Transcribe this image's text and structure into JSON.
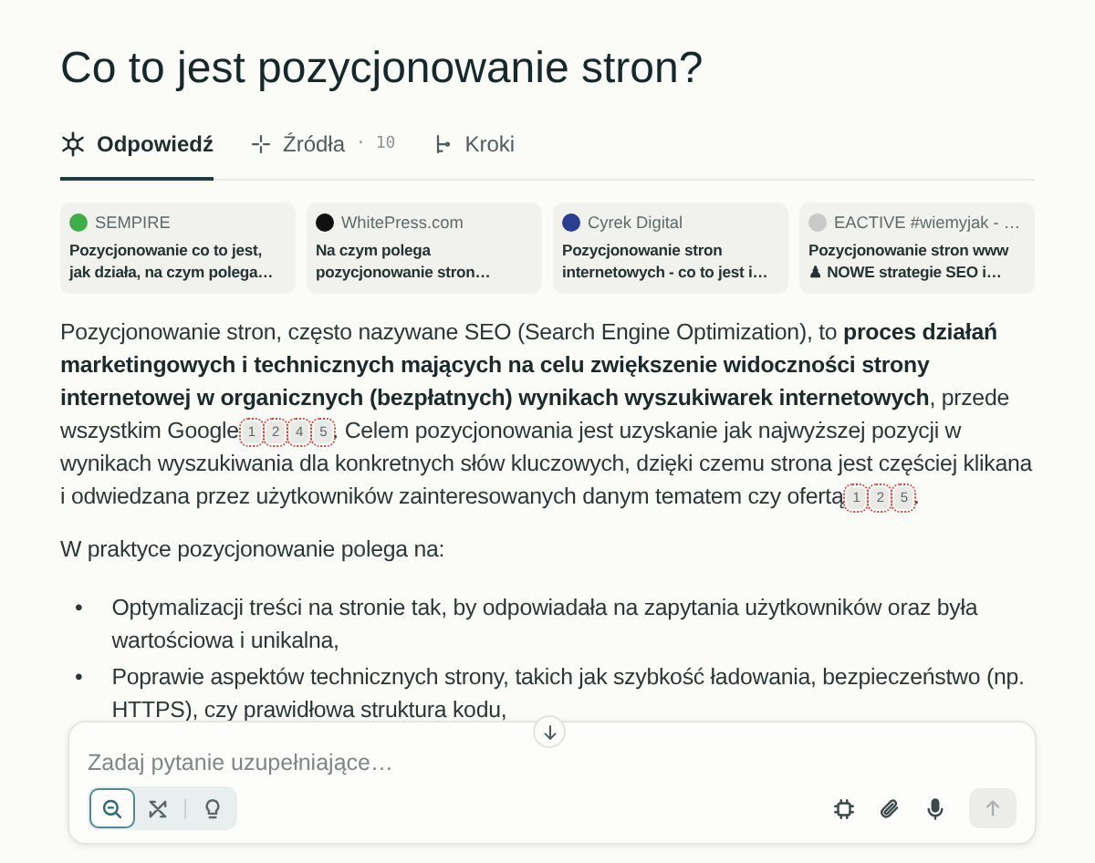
{
  "title": "Co to jest pozycjonowanie stron?",
  "tabs": [
    {
      "label": "Odpowiedź",
      "kind": "answer",
      "selected": true
    },
    {
      "label": "Źródła",
      "kind": "sources",
      "count": "· 10",
      "selected": false
    },
    {
      "label": "Kroki",
      "kind": "steps",
      "selected": false
    }
  ],
  "sources": [
    {
      "site": "SEMPIRE",
      "title": "Pozycjonowanie co to jest, jak działa, na czym polega…",
      "color": "#3fae49"
    },
    {
      "site": "WhitePress.com",
      "title": "Na czym polega pozycjonowanie stron…",
      "color": "#111111"
    },
    {
      "site": "Cyrek Digital",
      "title": "Pozycjonowanie stron internetowych - co to jest i…",
      "color": "#2a3f8f"
    },
    {
      "site": "EACTIVE #wiemyjak - …",
      "title": "Pozycjonowanie stron www ♟ NOWE strategie SEO i…",
      "color": "#c9c9c9"
    }
  ],
  "answer": {
    "paragraphs": [
      {
        "parts": [
          {
            "text": "Pozycjonowanie stron, często nazywane SEO (Search Engine Optimization), to **proces działań marketingowych i technicznych mających na celu zwiększenie widoczności strony internetowej w organicznych (bezpłatnych) wynikach wyszukiwarek internetowych**, przede wszystkim Google",
            "citations": [
              "1",
              "2",
              "4",
              "5"
            ]
          },
          {
            "text": ". Celem pozycjonowania jest uzyskanie jak najwyższej pozycji w wynikach wyszukiwania dla konkretnych słów kluczowych, dzięki czemu strona jest częściej klikana i odwiedzana przez użytkowników zainteresowanych danym tematem czy ofertą",
            "citations": [
              "1",
              "2",
              "5"
            ]
          },
          {
            "text": "."
          }
        ]
      },
      {
        "parts": [
          {
            "text": "W praktyce pozycjonowanie polega na:"
          }
        ]
      }
    ],
    "bullets": [
      {
        "marker": "•",
        "text": "Optymalizacji treści na stronie tak, by odpowiadała na zapytania użytkowników oraz była wartościowa i unikalna,"
      },
      {
        "marker": "•",
        "text": "Poprawie aspektów technicznych strony, takich jak szybkość ładowania, bezpieczeństwo (np. HTTPS), czy prawidłowa struktura kodu,"
      }
    ]
  },
  "composer": {
    "placeholder": "Zadaj pytanie uzupełniające…",
    "modes": [
      {
        "kind": "search",
        "selected": true
      },
      {
        "kind": "research",
        "selected": false
      },
      {
        "kind": "reasoning",
        "selected": false
      }
    ]
  }
}
